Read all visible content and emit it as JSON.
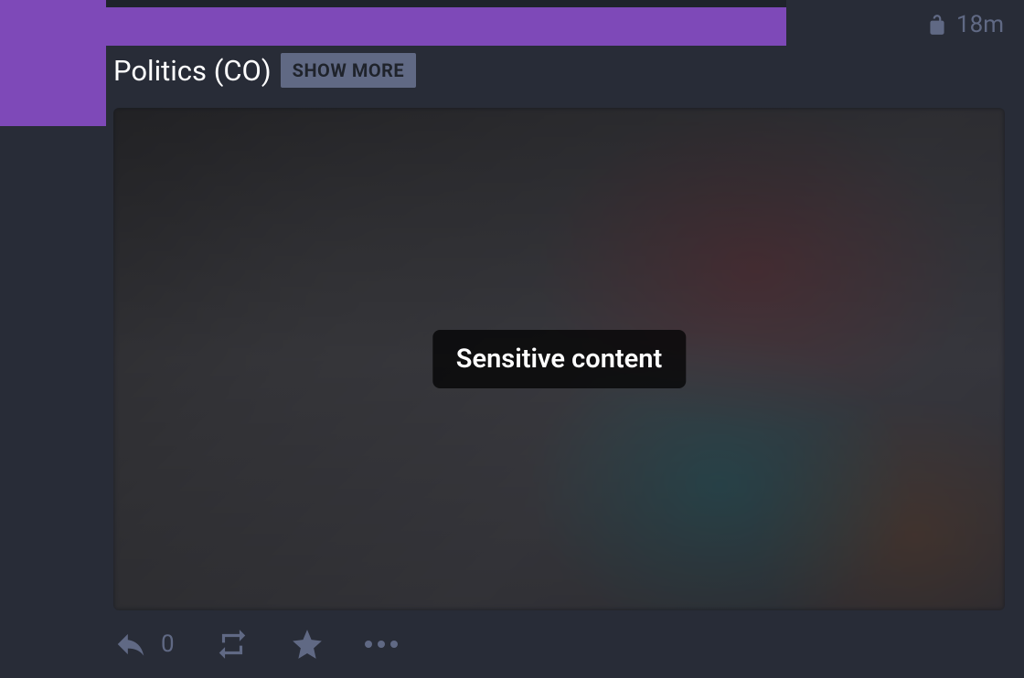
{
  "post": {
    "timestamp": "18m",
    "content_warning": "Politics (CO)",
    "show_more_label": "SHOW MORE",
    "sensitive_label": "Sensitive content",
    "reply_count": "0"
  }
}
